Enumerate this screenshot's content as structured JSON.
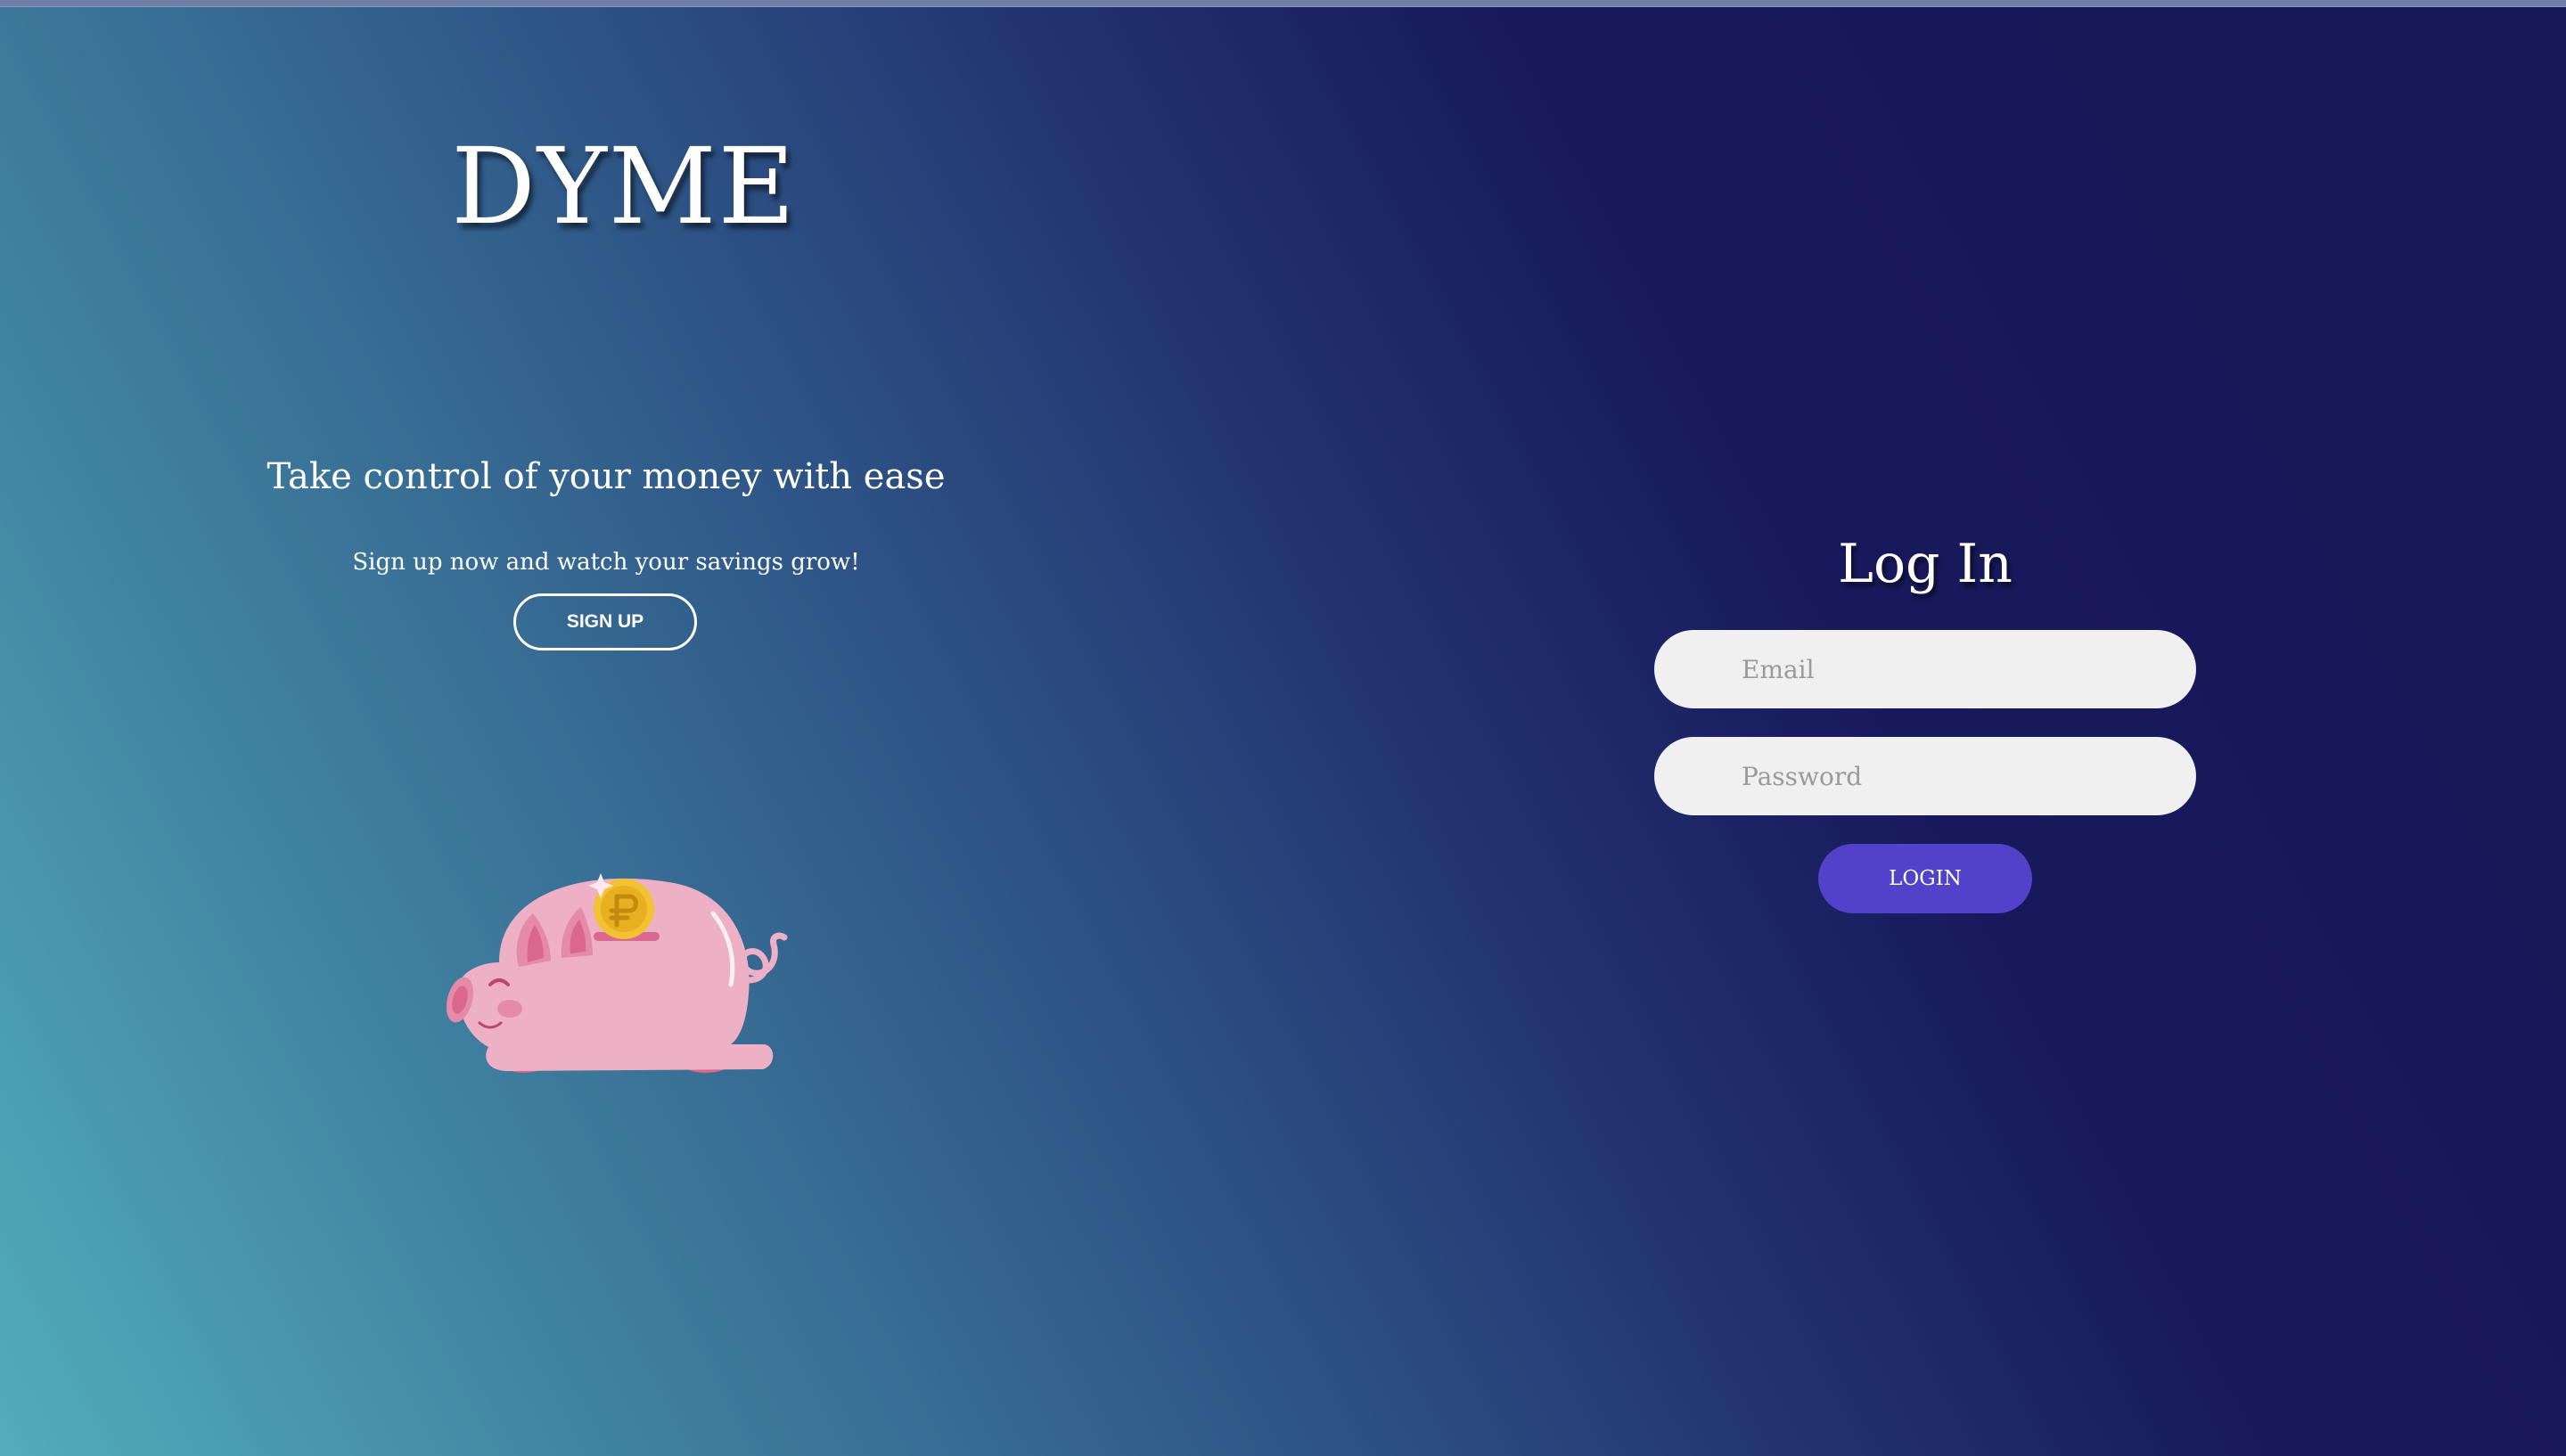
{
  "brand": {
    "name": "DYME"
  },
  "hero": {
    "tagline": "Take control of your money with ease",
    "subtext": "Sign up now and watch your savings grow!",
    "signup_label": "SIGN UP",
    "illustration_icon": "piggy-bank-icon"
  },
  "login": {
    "title": "Log In",
    "email_placeholder": "Email",
    "password_placeholder": "Password",
    "button_label": "LOGIN"
  },
  "colors": {
    "background_start": "#52adba",
    "background_end": "#161755",
    "login_button": "#5242c9",
    "input_background": "#f0f0f0",
    "piggy_pink": "#eeb0c4",
    "coin_gold": "#f1c232"
  }
}
